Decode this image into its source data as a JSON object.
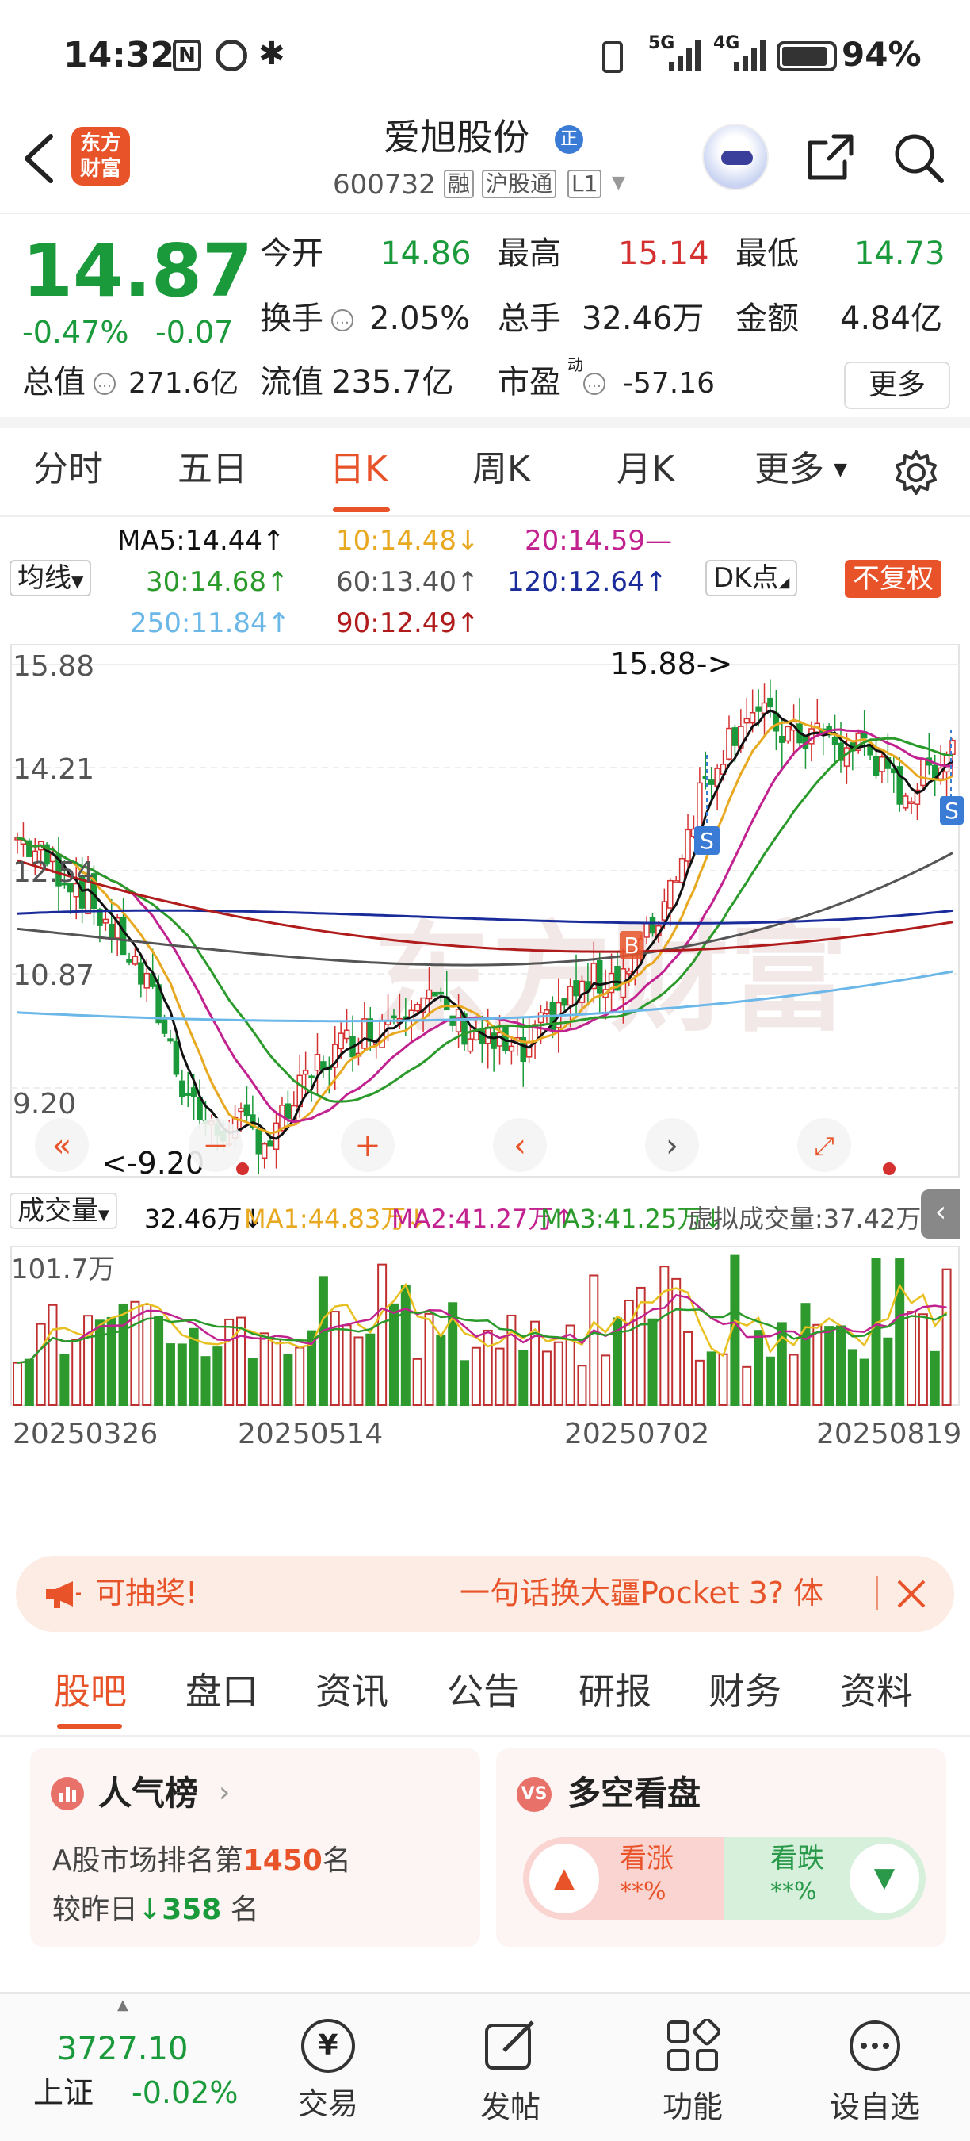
{
  "status_bar": {
    "time": "14:32",
    "battery": "94%",
    "net1": "5G",
    "net2": "4G"
  },
  "header": {
    "logo_text_1": "东方",
    "logo_text_2": "财富",
    "stock_name": "爱旭股份",
    "name_badge": "正",
    "stock_code": "600732",
    "tag_margin": "融",
    "tag_connect": "沪股通",
    "tag_level": "L1"
  },
  "quote": {
    "price": "14.87",
    "change_pct": "-0.47%",
    "change": "-0.07",
    "open_label": "今开",
    "open": "14.86",
    "high_label": "最高",
    "high": "15.14",
    "low_label": "最低",
    "low": "14.73",
    "turnover_label": "换手",
    "turnover": "2.05%",
    "volume_label": "总手",
    "volume": "32.46万",
    "amount_label": "金额",
    "amount": "4.84亿",
    "mktcap_label": "总值",
    "mktcap": "271.6亿",
    "float_label": "流值",
    "float": "235.7亿",
    "pe_label": "市盈",
    "pe_sup": "动",
    "pe": "-57.16",
    "more_btn": "更多"
  },
  "period_tabs": [
    "分时",
    "五日",
    "日K",
    "周K",
    "月K",
    "更多"
  ],
  "ma_legend": {
    "ma5": "MA5:14.44",
    "ma10": "10:14.48",
    "ma20": "20:14.59",
    "ma30": "30:14.68",
    "ma60": "60:13.40",
    "ma120": "120:12.64",
    "ma250": "250:11.84",
    "ma90": "90:12.49",
    "arrow_up": "↑",
    "arrow_down": "↓",
    "flat": "—",
    "ma_select": "均线",
    "dk_btn": "DK点",
    "adj_btn": "不复权"
  },
  "colors": {
    "ma5": "#111111",
    "ma10": "#e8a820",
    "ma20": "#c2228f",
    "ma30": "#2a9a2a",
    "ma60": "#555555",
    "ma120": "#1a2b9a",
    "ma250": "#6bb8e8",
    "ma90": "#b01c1c",
    "accent": "#e8532a"
  },
  "chart_data": {
    "type": "candlestick",
    "price_axis_ticks": [
      "15.88",
      "14.21",
      "12.54",
      "10.87",
      "9.20"
    ],
    "max_label": "15.88->",
    "min_label": "<-9.20",
    "markers": [
      "B",
      "S",
      "S"
    ],
    "date_ticks": [
      "20250326",
      "20250514",
      "20250702",
      "20250819"
    ],
    "volume_axis_max": "101.7万"
  },
  "volume_legend": {
    "label": "成交量",
    "value": "32.46万↓",
    "ma1": "MA1:44.83万↓",
    "ma2": "MA2:41.27万↑",
    "ma3": "MA3:41.25万↓",
    "virtual": "虚拟成交量:37.42万"
  },
  "banner": {
    "left": "可抽奖!",
    "right": "一句话换大疆Pocket 3? 体"
  },
  "section_tabs": [
    "股吧",
    "盘口",
    "资讯",
    "公告",
    "研报",
    "财务",
    "资料"
  ],
  "popularity": {
    "title": "人气榜",
    "rank_prefix": "A股市场排名第",
    "rank": "1450",
    "rank_suffix": "名",
    "change_prefix": "较昨日",
    "change": "358",
    "change_suffix": "名"
  },
  "sentiment": {
    "title": "多空看盘",
    "bull": "看涨",
    "bull_val": "**%",
    "bear": "看跌",
    "bear_val": "**%"
  },
  "bottom_nav": {
    "index_value": "3727.10",
    "index_name": "上证",
    "index_change": "-0.02%",
    "trade": "交易",
    "post": "发帖",
    "features": "功能",
    "watchlist": "设自选",
    "trade_icon_text": "¥"
  }
}
